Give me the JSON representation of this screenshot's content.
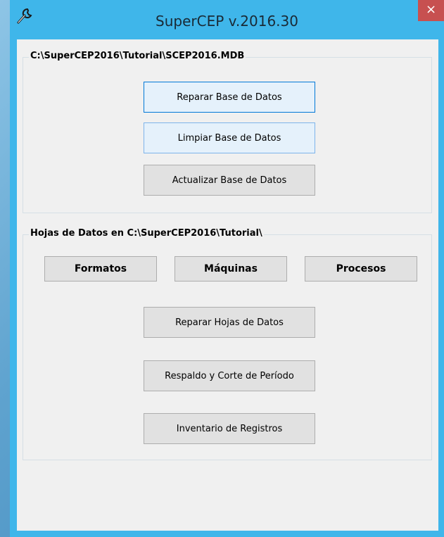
{
  "window": {
    "title": "SuperCEP v.2016.30",
    "close_label": "×",
    "icon": "wrench-icon"
  },
  "database_group": {
    "legend": "C:\\SuperCEP2016\\Tutorial\\SCEP2016.MDB",
    "repair_label": "Reparar Base de Datos",
    "clean_label": "Limpiar Base de Datos",
    "update_label": "Actualizar Base de Datos"
  },
  "datasheets_group": {
    "legend": "Hojas de Datos en C:\\SuperCEP2016\\Tutorial\\",
    "formats_label": "Formatos",
    "machines_label": "Máquinas",
    "processes_label": "Procesos",
    "repair_sheets_label": "Reparar Hojas de Datos",
    "backup_label": "Respaldo y Corte de Período",
    "inventory_label": "Inventario de Registros"
  },
  "colors": {
    "frame": "#3fb6ea",
    "close": "#c75050",
    "client": "#f0f0f0",
    "focus_border": "#0078d7"
  }
}
